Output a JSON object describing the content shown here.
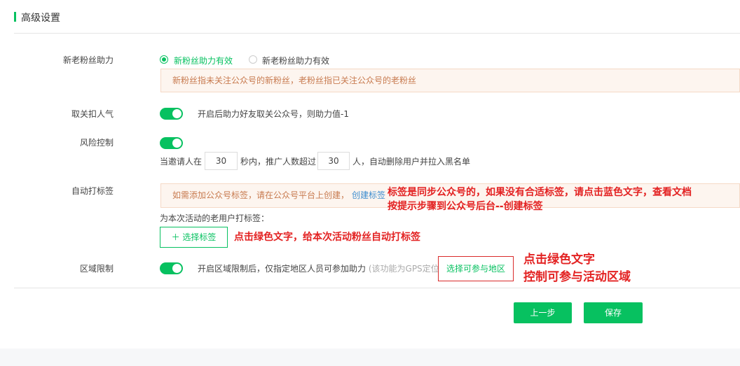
{
  "section": {
    "title": "高级设置"
  },
  "fan_help": {
    "label": "新老粉丝助力",
    "options": [
      "新粉丝助力有效",
      "新老粉丝助力有效"
    ],
    "selected": "新粉丝助力有效",
    "tip": "新粉丝指未关注公众号的新粉丝，老粉丝指已关注公众号的老粉丝"
  },
  "unfollow": {
    "label": "取关扣人气",
    "enabled": true,
    "desc": "开启后助力好友取关公众号，则助力值-1"
  },
  "risk": {
    "label": "风险控制",
    "enabled": true,
    "text_before": "当邀请人在",
    "seconds": "30",
    "text_mid": "秒内，推广人数超过",
    "count": "30",
    "text_after": "人，自动删除用户并拉入黑名单"
  },
  "auto_tag": {
    "label": "自动打标签",
    "tip": "如需添加公众号标签，请在公众号平台上创建，",
    "tip_link": "创建标签",
    "old_user_label": "为本次活动的老用户打标签：",
    "select_button": "＋ 选择标签",
    "annotation_line1": "标签是同步公众号的，如果没有合适标签，请点击蓝色文字，查看文档",
    "annotation_line2": "按提示步骤到公众号后台--创建标签",
    "annotation_select": "点击绿色文字，给本次活动粉丝自动打标签"
  },
  "region": {
    "label": "区域限制",
    "enabled": true,
    "desc": "开启区域限制后，仅指定地区人员可参加助力",
    "note": "(该功能为GPS定位)",
    "select_button": "选择可参与地区",
    "annotation_line1": "点击绿色文字",
    "annotation_line2": "控制可参与活动区域"
  },
  "actions": {
    "prev": "上一步",
    "save": "保存"
  },
  "colors": {
    "accent": "#07c160",
    "annotation": "#e32222",
    "link": "#3e8ed0",
    "tip_text": "#c87b50"
  }
}
